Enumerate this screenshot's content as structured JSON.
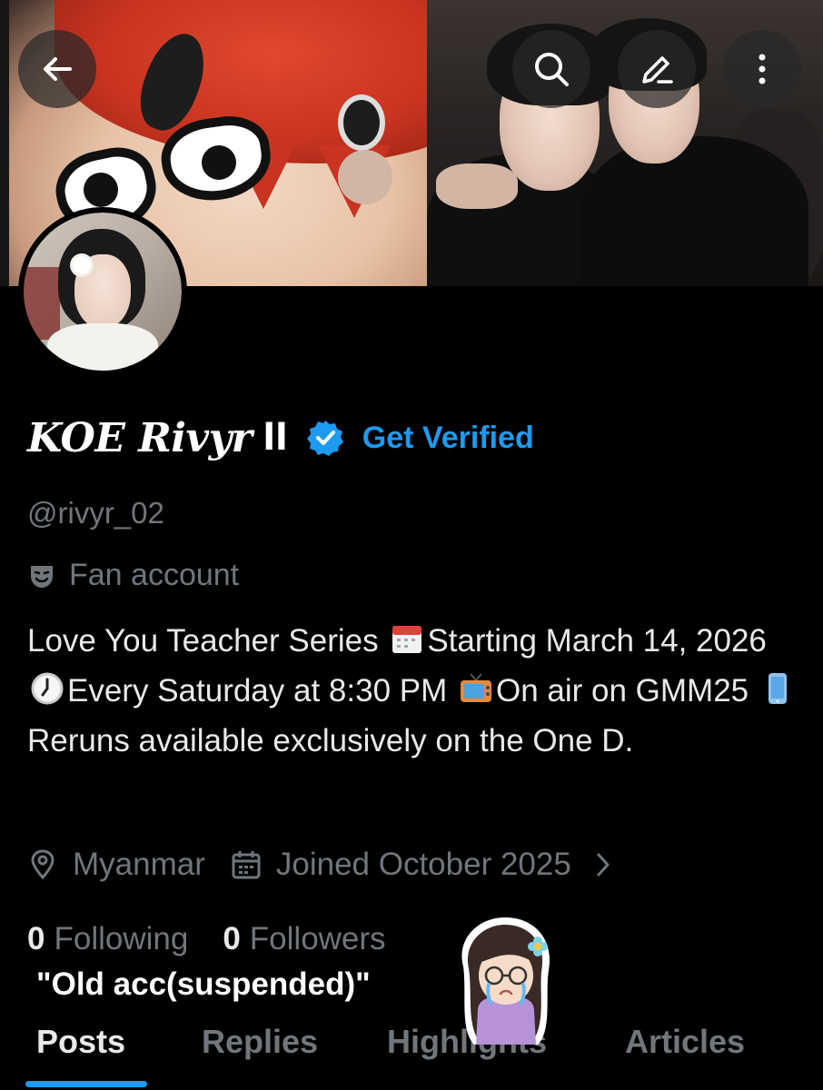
{
  "profile": {
    "display_name": "KOE Rivyr",
    "name_suffix": "ll",
    "get_verified_label": "Get Verified",
    "handle": "@rivyr_02",
    "category": "Fan account",
    "bio": {
      "part1": "Love You Teacher Series ",
      "part2": "Starting March 14, 2026 ",
      "part3": "Every Saturday at 8:30 PM ",
      "part4": "On air on GMM25 ",
      "part5": "Reruns available exclusively on the One D."
    },
    "location": "Myanmar",
    "joined": "Joined October 2025",
    "following_count": "0",
    "following_label": "Following",
    "followers_count": "0",
    "followers_label": "Followers"
  },
  "overlay_caption": "\"Old acc(suspended)\"",
  "tabs": [
    {
      "label": "Posts",
      "active": true
    },
    {
      "label": "Replies",
      "active": false
    },
    {
      "label": "Highlights",
      "active": false
    },
    {
      "label": "Articles",
      "active": false
    }
  ],
  "icons": {
    "back": "back-arrow-icon",
    "search": "search-icon",
    "edit": "edit-pencil-icon",
    "more": "more-vertical-icon",
    "verified": "verified-badge-icon",
    "category": "theater-mask-icon",
    "location": "location-pin-icon",
    "calendar": "calendar-icon"
  },
  "colors": {
    "background": "#000000",
    "accent": "#1d9bf0",
    "text_primary": "#e7e9ea",
    "text_secondary": "#71767b"
  }
}
